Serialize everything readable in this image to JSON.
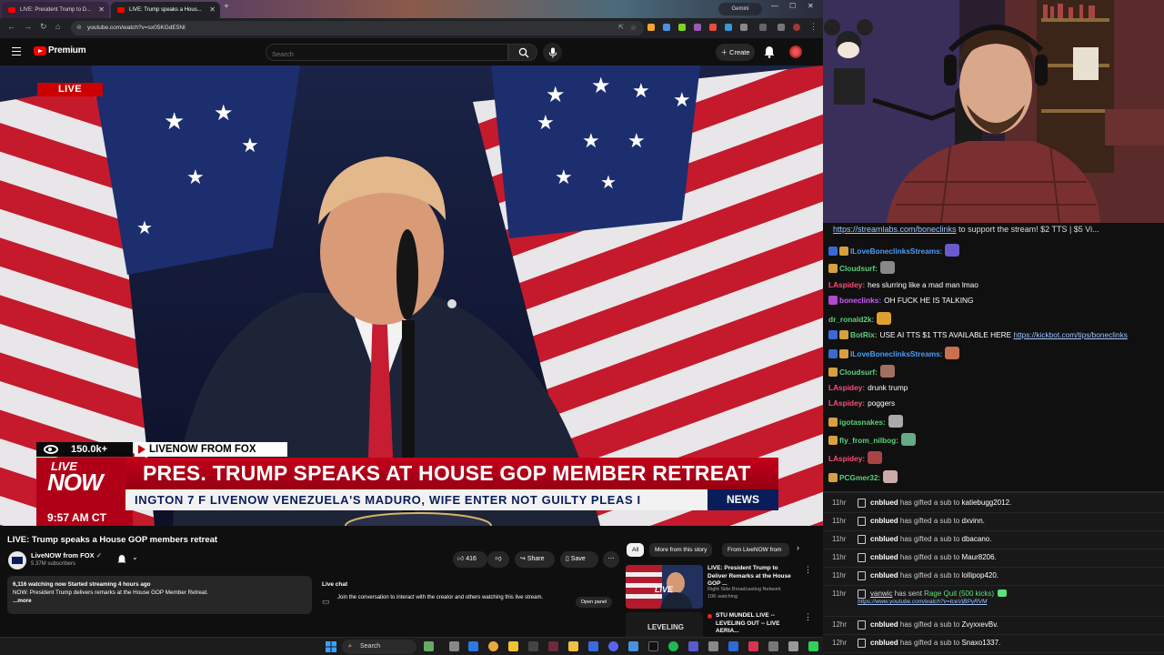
{
  "browser": {
    "tabs": [
      {
        "label": "LIVE: President Trump to D..."
      },
      {
        "label": "LIVE: Trump speaks a Hous..."
      }
    ],
    "profile_label": "Gemini",
    "url": "youtube.com/watch?v=sx05KGdE5NI"
  },
  "youtube": {
    "brand": "Premium",
    "search_placeholder": "Search",
    "create_label": "Create"
  },
  "video": {
    "live_label": "LIVE",
    "viewers": "150.0k+",
    "source": "LIVENOW FROM FOX",
    "livenow_l1": "LIVE",
    "livenow_l2": "NOW",
    "headline": "PRES. TRUMP SPEAKS AT HOUSE GOP MEMBER RETREAT",
    "ticker": "INGTON  7  F    LIVENOW   VENEZUELA'S MADURO, WIFE ENTER NOT GUILTY PLEAS I",
    "news_label": "NEWS",
    "time": "9:57 AM CT"
  },
  "watch": {
    "title": "LIVE: Trump speaks a House GOP members retreat",
    "channel": "LiveNOW from FOX",
    "subscribers": "5.37M subscribers",
    "likes": "416",
    "share": "Share",
    "save": "Save",
    "desc_line1": "6,116 watching now  Started streaming 4 hours ago",
    "desc_line2": "NOW: President Trump delivers remarks at the House GOP Member Retreat.",
    "desc_more": "...more",
    "livechat_title": "Live chat",
    "livechat_text": "Join the conversation to interact with the creator and others watching this live stream.",
    "open_panel": "Open panel"
  },
  "recommend": {
    "chips": [
      "All",
      "More from this story",
      "From LiveNOW from"
    ],
    "items": [
      {
        "title": "LIVE: President Trump to Deliver Remarks at the House GOP ...",
        "channel": "Right Side Broadcasting Network",
        "meta": "10K watching",
        "badge": "LIVE"
      },
      {
        "title": "STU MUNDEL LIVE -- LEVELING OUT -- LIVE AERIA...",
        "thumb_text": "LEVELING"
      }
    ]
  },
  "taskbar": {
    "search_label": "Search"
  },
  "chat": {
    "top_link": "https://streamlabs.com/boneclinks",
    "top_text": " to support the stream! $2 TTS | $5 Vi...",
    "messages": [
      {
        "user": "ILoveBoneclinksStreams:",
        "text": "",
        "color": "#4a9dff"
      },
      {
        "user": "Cloudsurf:",
        "text": "",
        "color": "#5ad17a"
      },
      {
        "user": "LAspidey:",
        "text": "hes slurring like a mad man lmao",
        "color": "#ff4b7a"
      },
      {
        "user": "boneclinks:",
        "text": "OH FUCK HE IS TALKING",
        "color": "#d15bff"
      },
      {
        "user": "dr_ronald2k:",
        "text": "",
        "color": "#5ad17a"
      },
      {
        "user": "BotRix:",
        "text": "USE AI TTS $1 TTS AVAILABLE HERE ",
        "link": "https://kickbot.com/tips/boneclinks",
        "color": "#5ad17a"
      },
      {
        "user": "ILoveBoneclinksStreams:",
        "text": "",
        "color": "#4a9dff"
      },
      {
        "user": "Cloudsurf:",
        "text": "",
        "color": "#5ad17a"
      },
      {
        "user": "LAspidey:",
        "text": "drunk trump",
        "color": "#ff4b7a"
      },
      {
        "user": "LAspidey:",
        "text": "poggers",
        "color": "#ff4b7a"
      },
      {
        "user": "igotasnakes:",
        "text": "",
        "color": "#5ad17a"
      },
      {
        "user": "fly_from_nilbog:",
        "text": "",
        "color": "#5ad17a"
      },
      {
        "user": "LAspidey:",
        "text": "",
        "color": "#ff4b7a"
      },
      {
        "user": "PCGmer32:",
        "text": "",
        "color": "#5ad17a"
      }
    ]
  },
  "events": [
    {
      "time": "11hr",
      "name": "cnblued",
      "text": "has gifted a sub to",
      "who": "katiebugg2012."
    },
    {
      "time": "11hr",
      "name": "cnblued",
      "text": "has gifted a sub to",
      "who": "dxvinn."
    },
    {
      "time": "11hr",
      "name": "cnblued",
      "text": "has gifted a sub to",
      "who": "dbacano."
    },
    {
      "time": "11hr",
      "name": "cnblued",
      "text": "has gifted a sub to",
      "who": "Maur8206."
    },
    {
      "time": "11hr",
      "name": "cnblued",
      "text": "has gifted a sub to",
      "who": "lollipop420."
    },
    {
      "time": "11hr",
      "name": "vanwic",
      "text": "has sent",
      "who": "Rage Quit (500 kicks)",
      "sub": "https://www.youtube.com/watch?v=tceVjBPyRVM"
    },
    {
      "time": "12hr",
      "name": "cnblued",
      "text": "has gifted a sub to",
      "who": "ZvyxxevBv."
    },
    {
      "time": "12hr",
      "name": "cnblued",
      "text": "has gifted a sub to",
      "who": "Snaxo1337."
    }
  ]
}
